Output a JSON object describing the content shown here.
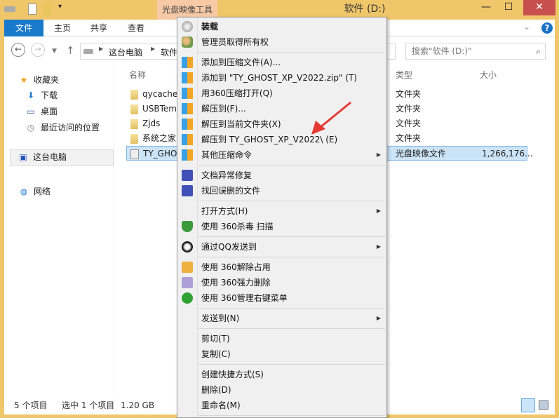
{
  "titlebar": {
    "contextual_tab": "光盘映像工具",
    "title": "软件 (D:)",
    "minimize": "—",
    "maximize": "☐",
    "close": "✕"
  },
  "ribbon": {
    "tabs": [
      "文件",
      "主页",
      "共享",
      "查看"
    ],
    "help": "?"
  },
  "address": {
    "crumbs": [
      "这台电脑",
      "软件"
    ],
    "search_placeholder": "搜索\"软件 (D:)\""
  },
  "nav": {
    "favorites": "收藏夹",
    "downloads": "下载",
    "desktop": "桌面",
    "recent": "最近访问的位置",
    "this_pc": "这台电脑",
    "network": "网络"
  },
  "columns": {
    "name": "名称",
    "type": "类型",
    "size": "大小"
  },
  "files": [
    {
      "name": "qycache",
      "type": "文件夹",
      "size": ""
    },
    {
      "name": "USBTem",
      "type": "文件夹",
      "size": ""
    },
    {
      "name": "Zjds",
      "type": "文件夹",
      "size": ""
    },
    {
      "name": "系统之家",
      "type": "文件夹",
      "size": ""
    },
    {
      "name": "TY_GHO",
      "type": "光盘映像文件",
      "size": "1,266,176..."
    }
  ],
  "status": {
    "count": "5 个项目",
    "selected": "选中 1 个项目",
    "size": "1.20 GB"
  },
  "menu": [
    {
      "label": "装载",
      "icon": "disc-icon",
      "bold": true
    },
    {
      "label": "管理员取得所有权",
      "icon": "users-icon"
    },
    {
      "sep": true
    },
    {
      "label": "添加到压缩文件(A)...",
      "icon": "zip-icon"
    },
    {
      "label": "添加到 \"TY_GHOST_XP_V2022.zip\" (T)",
      "icon": "zip-icon"
    },
    {
      "label": "用360压缩打开(Q)",
      "icon": "zip-icon"
    },
    {
      "label": "解压到(F)...",
      "icon": "zip-icon"
    },
    {
      "label": "解压到当前文件夹(X)",
      "icon": "zip-icon"
    },
    {
      "label": "解压到 TY_GHOST_XP_V2022\\ (E)",
      "icon": "zip-icon"
    },
    {
      "label": "其他压缩命令",
      "icon": "zip-icon",
      "submenu": true
    },
    {
      "sep": true
    },
    {
      "label": "文档异常修复",
      "icon": "repair-icon"
    },
    {
      "label": "找回误删的文件",
      "icon": "recover-icon"
    },
    {
      "sep": true
    },
    {
      "label": "打开方式(H)",
      "submenu": true
    },
    {
      "label": "使用 360杀毒 扫描",
      "icon": "shield-icon"
    },
    {
      "sep": true
    },
    {
      "label": "通过QQ发送到",
      "icon": "qq-icon",
      "submenu": true
    },
    {
      "sep": true
    },
    {
      "label": "使用 360解除占用",
      "icon": "unlock-icon"
    },
    {
      "label": "使用 360强力删除",
      "icon": "shred-icon"
    },
    {
      "label": "使用 360管理右键菜单",
      "icon": "plus-icon"
    },
    {
      "sep": true
    },
    {
      "label": "发送到(N)",
      "submenu": true
    },
    {
      "sep": true
    },
    {
      "label": "剪切(T)"
    },
    {
      "label": "复制(C)"
    },
    {
      "sep": true
    },
    {
      "label": "创建快捷方式(S)"
    },
    {
      "label": "删除(D)"
    },
    {
      "label": "重命名(M)"
    },
    {
      "sep": true
    }
  ],
  "colors": {
    "frame": "#efc66a",
    "accent": "#1979ca",
    "selection": "#cce4f7",
    "close": "#c7504f",
    "arrow": "#e53935"
  }
}
